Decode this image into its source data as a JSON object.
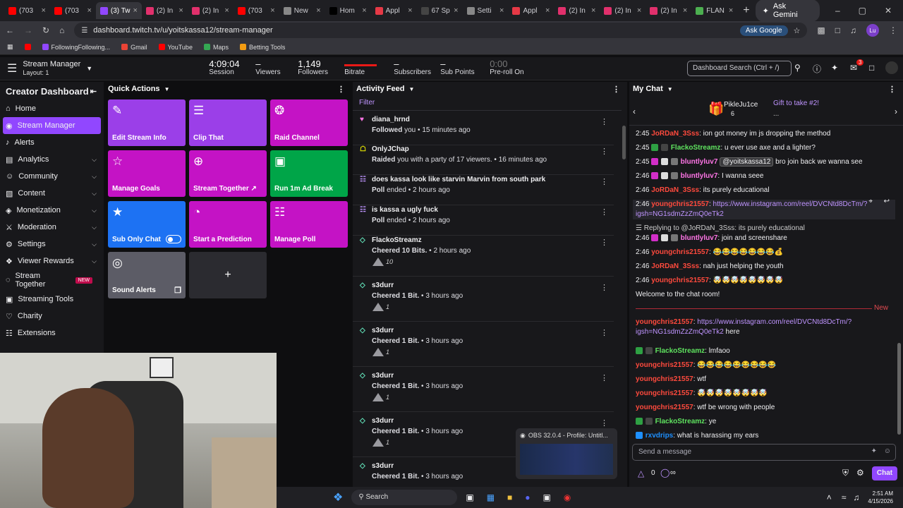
{
  "browser": {
    "tabs": [
      {
        "label": "(703",
        "color": "#ff0000"
      },
      {
        "label": "(703",
        "color": "#ff0000"
      },
      {
        "label": "(3) Tw",
        "color": "#9147ff",
        "active": true
      },
      {
        "label": "(2) In",
        "color": "#e1306c"
      },
      {
        "label": "(2) In",
        "color": "#e1306c"
      },
      {
        "label": "(703",
        "color": "#ff0000"
      },
      {
        "label": "New",
        "color": "#888888"
      },
      {
        "label": "Hom",
        "color": "#000000"
      },
      {
        "label": "Appl",
        "color": "#e63946"
      },
      {
        "label": "67 Sp",
        "color": "#444444"
      },
      {
        "label": "Setti",
        "color": "#888888"
      },
      {
        "label": "Appl",
        "color": "#e63946"
      },
      {
        "label": "(2) In",
        "color": "#e1306c"
      },
      {
        "label": "(2) In",
        "color": "#e1306c"
      },
      {
        "label": "(2) In",
        "color": "#e1306c"
      },
      {
        "label": "FLAN",
        "color": "#4caf50"
      }
    ],
    "gemini": "Ask Gemini",
    "url": "dashboard.twitch.tv/u/yoitskassa12/stream-manager",
    "ask_google": "Ask Google",
    "profile": "Lu",
    "bookmarks": [
      "FollowingFollowing...",
      "Gmail",
      "YouTube",
      "Maps",
      "Betting Tools"
    ]
  },
  "header": {
    "title": "Stream Manager",
    "layout": "Layout: 1",
    "stats": [
      {
        "value": "4:09:04",
        "label": "Session"
      },
      {
        "value": "–",
        "label": "Viewers"
      },
      {
        "value": "1,149",
        "label": "Followers"
      },
      {
        "value": "",
        "label": "Bitrate"
      },
      {
        "value": "–",
        "label": "Subscribers"
      },
      {
        "value": "–",
        "label": "Sub Points"
      },
      {
        "value": "0:00",
        "label": "Pre-roll On"
      }
    ],
    "search_placeholder": "Dashboard Search (Ctrl + /)",
    "notif_count": "3"
  },
  "sidebar": {
    "title": "Creator Dashboard",
    "items": [
      {
        "label": "Home",
        "icon": "home-icon"
      },
      {
        "label": "Stream Manager",
        "icon": "broadcast-icon",
        "active": true
      },
      {
        "label": "Alerts",
        "icon": "bell-icon"
      },
      {
        "label": "Analytics",
        "icon": "chart-icon",
        "chev": true
      },
      {
        "label": "Community",
        "icon": "people-icon",
        "chev": true
      },
      {
        "label": "Content",
        "icon": "content-icon",
        "chev": true
      },
      {
        "label": "Monetization",
        "icon": "money-icon",
        "chev": true
      },
      {
        "label": "Moderation",
        "icon": "sword-icon",
        "chev": true
      },
      {
        "label": "Settings",
        "icon": "gear-icon",
        "chev": true
      },
      {
        "label": "Viewer Rewards",
        "icon": "gift-icon",
        "chev": true
      },
      {
        "label": "Stream Together",
        "icon": "together-icon",
        "badge": "NEW"
      },
      {
        "label": "Streaming Tools",
        "icon": "tools-icon"
      },
      {
        "label": "Charity",
        "icon": "heart-icon"
      },
      {
        "label": "Extensions",
        "icon": "puzzle-icon"
      }
    ]
  },
  "quick_actions": {
    "title": "Quick Actions",
    "tiles": [
      {
        "label": "Edit Stream Info",
        "icon": "✎",
        "color": "#9b3fe8"
      },
      {
        "label": "Clip That",
        "icon": "☰",
        "color": "#9b3fe8"
      },
      {
        "label": "Raid Channel",
        "icon": "❂",
        "color": "#c413c5"
      },
      {
        "label": "Manage Goals",
        "icon": "☆",
        "color": "#c413c5"
      },
      {
        "label": "Stream Together ↗",
        "icon": "⊕",
        "color": "#c413c5"
      },
      {
        "label": "Run 1m Ad Break",
        "icon": "▣",
        "color": "#00a548"
      },
      {
        "label": "Sub Only Chat",
        "icon": "★",
        "color": "#1d72f3"
      },
      {
        "label": "Start a Prediction",
        "icon": "◔",
        "color": "#c413c5"
      },
      {
        "label": "Manage Poll",
        "icon": "☷",
        "color": "#c413c5"
      },
      {
        "label": "Sound Alerts",
        "icon": "◎",
        "color": "#5c5c66"
      }
    ]
  },
  "activity": {
    "title": "Activity Feed",
    "filter": "Filter",
    "items": [
      {
        "name": "diana_hrnd",
        "action": "Followed",
        "rest": "you",
        "time": "15 minutes ago",
        "icon": "heart",
        "color": "#ff75e6"
      },
      {
        "name": "OnlyJChap",
        "action": "Raided",
        "rest": "you with a party of 17 viewers.",
        "time": "16 minutes ago",
        "icon": "raid",
        "color": "#f0f000"
      },
      {
        "name": "does kassa look like starvin Marvin from south park",
        "action": "Poll",
        "rest": "ended",
        "time": "2 hours ago",
        "icon": "poll",
        "color": "#bf94ff"
      },
      {
        "name": "is kassa a ugly fuck",
        "action": "Poll",
        "rest": "ended",
        "time": "2 hours ago",
        "icon": "poll",
        "color": "#bf94ff"
      },
      {
        "name": "FlackoStreamz",
        "action": "Cheered",
        "rest": "10 Bits.",
        "time": "2 hours ago",
        "icon": "bits",
        "color": "#64e8be",
        "cheer": "10"
      },
      {
        "name": "s3durr",
        "action": "Cheered",
        "rest": "1 Bit.",
        "time": "3 hours ago",
        "icon": "bits",
        "color": "#64e8be",
        "cheer": "1"
      },
      {
        "name": "s3durr",
        "action": "Cheered",
        "rest": "1 Bit.",
        "time": "3 hours ago",
        "icon": "bits",
        "color": "#64e8be",
        "cheer": "1"
      },
      {
        "name": "s3durr",
        "action": "Cheered",
        "rest": "1 Bit.",
        "time": "3 hours ago",
        "icon": "bits",
        "color": "#64e8be",
        "cheer": "1"
      },
      {
        "name": "s3durr",
        "action": "Cheered",
        "rest": "1 Bit.",
        "time": "3 hours ago",
        "icon": "bits",
        "color": "#64e8be",
        "cheer": "1"
      },
      {
        "name": "s3durr",
        "action": "Cheered",
        "rest": "1 Bit.",
        "time": "3 hours ago",
        "icon": "bits",
        "color": "#64e8be"
      }
    ]
  },
  "chat": {
    "title": "My Chat",
    "pinned_user": "PikleJu1ce",
    "pinned_count": "6",
    "gift_text": "Gift to take #2!",
    "gift_sub": "...",
    "messages": [
      {
        "time": "2:45",
        "user": "JoRDaN_3Sss",
        "ucolor": "#ff4a3d",
        "text": ": ion got money im js dropping the method"
      },
      {
        "time": "2:45",
        "user": "FlackoStreamz",
        "ucolor": "#5fe35f",
        "text": ": u ever use axe and a lighter?",
        "badges": [
          "#2ea043",
          "#444"
        ]
      },
      {
        "time": "2:45",
        "user": "bluntlyluv7",
        "ucolor": "#ff75e6",
        "text": " bro join back we wanna see",
        "mention": "@yoitskassa12",
        "badges": [
          "#d22ec8",
          "#ddd",
          "#777"
        ]
      },
      {
        "time": "2:46",
        "user": "bluntlyluv7",
        "ucolor": "#ff75e6",
        "text": ": I wanna seee",
        "badges": [
          "#d22ec8",
          "#ddd",
          "#777"
        ]
      },
      {
        "time": "2:46",
        "user": "JoRDaN_3Sss",
        "ucolor": "#ff4a3d",
        "text": ": its purely educational"
      },
      {
        "time": "2:46",
        "user": "youngchris21557",
        "ucolor": "#ff4a3d",
        "text": ": ",
        "link": "https://www.instagram.com/reel/DVCNtd8DcTm/?",
        "link2": "igsh=NG1sdmZzZmQ0eTk2"
      },
      {
        "reply": "Replying to @JoRDaN_3Sss: its purely educational"
      },
      {
        "time": "2:46",
        "user": "bluntlyluv7",
        "ucolor": "#ff75e6",
        "text": ": join and screenshare",
        "badges": [
          "#d22ec8",
          "#ddd",
          "#777"
        ]
      },
      {
        "time": "2:46",
        "user": "youngchris21557",
        "ucolor": "#ff4a3d",
        "text": ": 😂😂😂😂😂😂😂💰"
      },
      {
        "time": "2:46",
        "user": "JoRDaN_3Sss",
        "ucolor": "#ff4a3d",
        "text": ": nah just helping the youth"
      },
      {
        "time": "2:46",
        "user": "youngchris21557",
        "ucolor": "#ff4a3d",
        "text": ": 🤯🤯🤯🤯🤯🤯🤯🤯"
      },
      {
        "welcome": "Welcome to the chat room!"
      }
    ],
    "new_label": "New",
    "messages2": [
      {
        "user": "youngchris21557",
        "ucolor": "#ff4a3d",
        "text": ": ",
        "link": "https://www.instagram.com/reel/DVCNtd8DcTm/?",
        "link2": "igsh=NG1sdmZzZmQ0eTk2",
        "tail": " here"
      },
      {
        "user": "FlackoStreamz",
        "ucolor": "#5fe35f",
        "text": ": lmfaoo",
        "badges": [
          "#2ea043",
          "#444"
        ]
      },
      {
        "user": "youngchris21557",
        "ucolor": "#ff4a3d",
        "text": ": 😂😂😂😂😂😂😂😂😂"
      },
      {
        "user": "youngchris21557",
        "ucolor": "#ff4a3d",
        "text": ": wtf"
      },
      {
        "user": "youngchris21557",
        "ucolor": "#ff4a3d",
        "text": ": 🤯🤯🤯🤯🤯🤯🤯🤯"
      },
      {
        "user": "youngchris21557",
        "ucolor": "#ff4a3d",
        "text": ": wtf be wrong with people"
      },
      {
        "user": "FlackoStreamz",
        "ucolor": "#5fe35f",
        "text": ": ye",
        "badges": [
          "#2ea043",
          "#444"
        ]
      },
      {
        "user": "rxvdrips",
        "ucolor": "#1e90ff",
        "text": ": what is harassing my ears",
        "badges": [
          "#1e90ff"
        ]
      }
    ],
    "input_placeholder": "Send a message",
    "points": "0",
    "infinity": "∞",
    "send": "Chat"
  },
  "obs": {
    "title": "OBS 32.0.4 - Profile: Untitl..."
  },
  "taskbar": {
    "search": "Search",
    "time": "2:51 AM",
    "date": "4/15/2026"
  }
}
